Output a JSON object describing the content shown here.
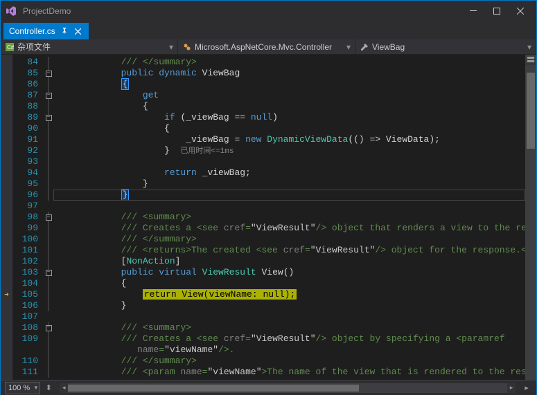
{
  "window": {
    "title": "ProjectDemo"
  },
  "tab": {
    "label": "Controller.cs"
  },
  "nav": {
    "scope_icon": "csharp-icon",
    "scope": "杂项文件",
    "class_icon": "class-icon",
    "class": "Microsoft.AspNetCore.Mvc.Controller",
    "member_icon": "property-icon",
    "member": "ViewBag"
  },
  "zoom": "100 %",
  "code_lens_hint": "已用时间<=1ms",
  "lines": [
    {
      "n": 84,
      "outline": "line",
      "segs": [
        [
          "ig",
          3
        ],
        [
          "comment",
          "/// </summary>"
        ]
      ]
    },
    {
      "n": 85,
      "outline": "box",
      "segs": [
        [
          "ig",
          3
        ],
        [
          "keyword",
          "public "
        ],
        [
          "keyword",
          "dynamic "
        ],
        [
          "ident",
          "ViewBag"
        ]
      ]
    },
    {
      "n": 86,
      "outline": "line",
      "segs": [
        [
          "ig",
          3
        ],
        [
          "brace_open",
          "{"
        ]
      ]
    },
    {
      "n": 87,
      "outline": "box",
      "segs": [
        [
          "ig",
          4
        ],
        [
          "keyword",
          "get"
        ]
      ]
    },
    {
      "n": 88,
      "outline": "line",
      "segs": [
        [
          "ig",
          4
        ],
        [
          "ident",
          "{"
        ]
      ]
    },
    {
      "n": 89,
      "outline": "box",
      "segs": [
        [
          "ig",
          5
        ],
        [
          "keyword",
          "if "
        ],
        [
          "ident",
          "(_viewBag == "
        ],
        [
          "keyword",
          "null"
        ],
        [
          "ident",
          ")"
        ]
      ]
    },
    {
      "n": 90,
      "outline": "line",
      "segs": [
        [
          "ig",
          5
        ],
        [
          "ident",
          "{"
        ]
      ]
    },
    {
      "n": 91,
      "outline": "line",
      "segs": [
        [
          "ig",
          6
        ],
        [
          "ident",
          "_viewBag = "
        ],
        [
          "keyword",
          "new "
        ],
        [
          "type",
          "DynamicViewData"
        ],
        [
          "ident",
          "(() => ViewData);"
        ]
      ]
    },
    {
      "n": 92,
      "outline": "line",
      "segs": [
        [
          "ig",
          5
        ],
        [
          "ident",
          "}  "
        ],
        [
          "hint",
          "HINT"
        ]
      ]
    },
    {
      "n": 93,
      "outline": "line",
      "segs": [
        [
          "ig",
          4
        ],
        [
          "ident",
          ""
        ]
      ]
    },
    {
      "n": 94,
      "outline": "line",
      "segs": [
        [
          "ig",
          5
        ],
        [
          "keyword",
          "return "
        ],
        [
          "ident",
          "_viewBag;"
        ]
      ]
    },
    {
      "n": 95,
      "outline": "line",
      "segs": [
        [
          "ig",
          4
        ],
        [
          "ident",
          "}"
        ]
      ]
    },
    {
      "n": 96,
      "outline": "line",
      "current": true,
      "segs": [
        [
          "ig",
          3
        ],
        [
          "brace_close",
          "}"
        ]
      ]
    },
    {
      "n": 97,
      "outline": "",
      "segs": [
        [
          "ig",
          0
        ],
        [
          "ident",
          ""
        ]
      ]
    },
    {
      "n": 98,
      "outline": "box",
      "segs": [
        [
          "ig",
          3
        ],
        [
          "comment",
          "/// <summary>"
        ]
      ]
    },
    {
      "n": 99,
      "outline": "line",
      "segs": [
        [
          "ig",
          3
        ],
        [
          "comment",
          "/// Creates a <see "
        ],
        [
          "xmlattr",
          "cref"
        ],
        [
          "comment",
          "="
        ],
        [
          "xmlval",
          "\"ViewResult\""
        ],
        [
          "comment",
          "/> object that renders a view to the response."
        ]
      ]
    },
    {
      "n": 100,
      "outline": "line",
      "segs": [
        [
          "ig",
          3
        ],
        [
          "comment",
          "/// </summary>"
        ]
      ]
    },
    {
      "n": 101,
      "outline": "line",
      "segs": [
        [
          "ig",
          3
        ],
        [
          "comment",
          "/// <returns>The created <see "
        ],
        [
          "xmlattr",
          "cref"
        ],
        [
          "comment",
          "="
        ],
        [
          "xmlval",
          "\"ViewResult\""
        ],
        [
          "comment",
          "/> object for the response.</returns>"
        ]
      ]
    },
    {
      "n": 102,
      "outline": "line",
      "segs": [
        [
          "ig",
          3
        ],
        [
          "ident",
          "["
        ],
        [
          "type",
          "NonAction"
        ],
        [
          "ident",
          "]"
        ]
      ]
    },
    {
      "n": 103,
      "outline": "box",
      "segs": [
        [
          "ig",
          3
        ],
        [
          "keyword",
          "public "
        ],
        [
          "keyword",
          "virtual "
        ],
        [
          "type",
          "ViewResult "
        ],
        [
          "ident",
          "View()"
        ]
      ]
    },
    {
      "n": 104,
      "outline": "line",
      "segs": [
        [
          "ig",
          3
        ],
        [
          "ident",
          "{"
        ]
      ]
    },
    {
      "n": 105,
      "outline": "line",
      "exec": true,
      "segs": [
        [
          "ig",
          4
        ],
        [
          "highlight",
          "return View(viewName: null);"
        ]
      ]
    },
    {
      "n": 106,
      "outline": "line",
      "segs": [
        [
          "ig",
          3
        ],
        [
          "ident",
          "}"
        ]
      ]
    },
    {
      "n": 107,
      "outline": "",
      "segs": [
        [
          "ig",
          0
        ],
        [
          "ident",
          ""
        ]
      ]
    },
    {
      "n": 108,
      "outline": "box",
      "segs": [
        [
          "ig",
          3
        ],
        [
          "comment",
          "/// <summary>"
        ]
      ]
    },
    {
      "n": 109,
      "outline": "line",
      "segs": [
        [
          "ig",
          3
        ],
        [
          "comment",
          "/// Creates a <see "
        ],
        [
          "xmlattr",
          "cref"
        ],
        [
          "comment",
          "="
        ],
        [
          "xmlval",
          "\"ViewResult\""
        ],
        [
          "comment",
          "/> object by specifying a <paramref"
        ]
      ]
    },
    {
      "n": "",
      "outline": "line",
      "segs": [
        [
          "ig",
          3
        ],
        [
          "comment",
          "   "
        ],
        [
          "xmlattr",
          "name"
        ],
        [
          "comment",
          "="
        ],
        [
          "xmlval",
          "\"viewName\""
        ],
        [
          "comment",
          "/>."
        ]
      ]
    },
    {
      "n": 110,
      "outline": "line",
      "segs": [
        [
          "ig",
          3
        ],
        [
          "comment",
          "/// </summary>"
        ]
      ]
    },
    {
      "n": 111,
      "outline": "line",
      "segs": [
        [
          "ig",
          3
        ],
        [
          "comment",
          "/// <param "
        ],
        [
          "xmlattr",
          "name"
        ],
        [
          "comment",
          "="
        ],
        [
          "xmlval",
          "\"viewName\""
        ],
        [
          "comment",
          ">The name of the view that is rendered to the response.</"
        ]
      ]
    }
  ]
}
